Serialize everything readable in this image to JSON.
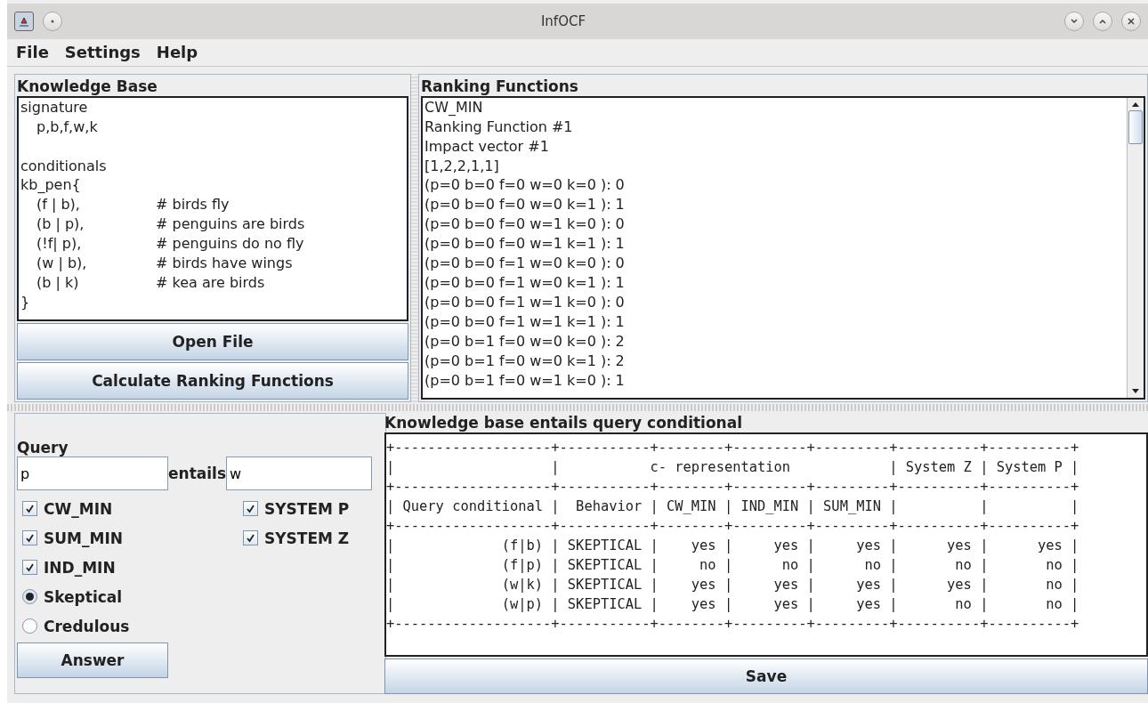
{
  "window": {
    "title": "InfOCF"
  },
  "menu": [
    "File",
    "Settings",
    "Help"
  ],
  "knowledge_base": {
    "title": "Knowledge Base",
    "lines": [
      {
        "kind": "section",
        "text": "signature"
      },
      {
        "kind": "entry",
        "text": "p,b,f,w,k"
      },
      {
        "kind": "blank"
      },
      {
        "kind": "section",
        "text": "conditionals"
      },
      {
        "kind": "section",
        "text": "kb_pen{"
      },
      {
        "kind": "entry",
        "text": "(f | b),",
        "comment": "# birds fly"
      },
      {
        "kind": "entry",
        "text": "(b | p),",
        "comment": "# penguins are birds"
      },
      {
        "kind": "entry",
        "text": "(!f| p),",
        "comment": "# penguins do no fly"
      },
      {
        "kind": "entry",
        "text": "(w | b),",
        "comment": "# birds have wings"
      },
      {
        "kind": "entry",
        "text": "(b | k)",
        "comment": "# kea are birds"
      },
      {
        "kind": "section",
        "text": "}"
      }
    ],
    "buttons": [
      "Open File",
      "Calculate Ranking Functions"
    ]
  },
  "ranking_functions": {
    "title": "Ranking Functions",
    "lines": [
      "CW_MIN",
      "Ranking Function #1",
      "Impact vector #1",
      "[1,2,2,1,1]",
      "(p=0 b=0 f=0 w=0 k=0 ): 0",
      "(p=0 b=0 f=0 w=0 k=1 ): 1",
      "(p=0 b=0 f=0 w=1 k=0 ): 0",
      "(p=0 b=0 f=0 w=1 k=1 ): 1",
      "(p=0 b=0 f=1 w=0 k=0 ): 0",
      "(p=0 b=0 f=1 w=0 k=1 ): 1",
      "(p=0 b=0 f=1 w=1 k=0 ): 0",
      "(p=0 b=0 f=1 w=1 k=1 ): 1",
      "(p=0 b=1 f=0 w=0 k=0 ): 2",
      "(p=0 b=1 f=0 w=0 k=1 ): 2",
      "(p=0 b=1 f=0 w=1 k=0 ): 1"
    ]
  },
  "query": {
    "title": "Query",
    "left": "p",
    "connector": "entails",
    "right": "w",
    "options_left": [
      {
        "kind": "checkbox",
        "label": "CW_MIN",
        "checked": true
      },
      {
        "kind": "checkbox",
        "label": "SUM_MIN",
        "checked": true
      },
      {
        "kind": "checkbox",
        "label": "IND_MIN",
        "checked": true
      },
      {
        "kind": "radio",
        "label": "Skeptical",
        "selected": true
      },
      {
        "kind": "radio",
        "label": "Credulous",
        "selected": false
      }
    ],
    "options_right": [
      {
        "kind": "checkbox",
        "label": "SYSTEM P",
        "checked": true
      },
      {
        "kind": "checkbox",
        "label": "SYSTEM Z",
        "checked": true
      }
    ],
    "button": "Answer"
  },
  "result": {
    "title": "Knowledge base entails query conditional",
    "lines": [
      "+-------------------+-----------+--------+---------+---------+----------+----------+",
      "|                   |           c- representation            | System Z | System P |",
      "+-------------------+-----------+--------+---------+---------+----------+----------+",
      "| Query conditional |  Behavior | CW_MIN | IND_MIN | SUM_MIN |          |          |",
      "+-------------------+-----------+--------+---------+---------+----------+----------+",
      "|             (f|b) | SKEPTICAL |    yes |     yes |     yes |      yes |      yes |",
      "|             (f|p) | SKEPTICAL |     no |      no |      no |       no |       no |",
      "|             (w|k) | SKEPTICAL |    yes |     yes |     yes |      yes |       no |",
      "|             (w|p) | SKEPTICAL |    yes |     yes |     yes |       no |       no |",
      "+-------------------+-----------+--------+---------+---------+----------+----------+"
    ],
    "button": "Save"
  }
}
